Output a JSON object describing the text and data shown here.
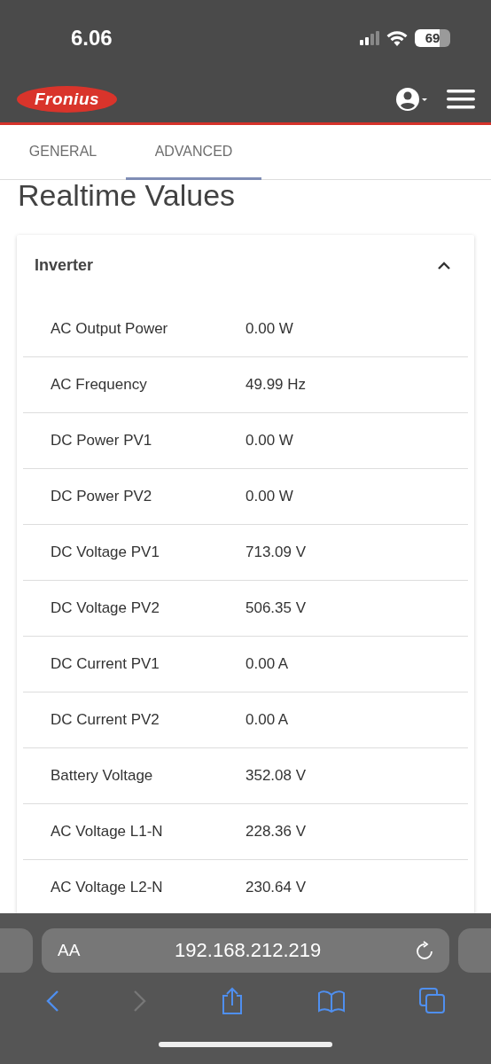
{
  "status_bar": {
    "time": "6.06",
    "battery": "69"
  },
  "header": {
    "logo": "Fronius"
  },
  "tabs": [
    {
      "label": "GENERAL",
      "selected": false
    },
    {
      "label": "ADVANCED",
      "selected": true
    }
  ],
  "page_title": "Realtime Values",
  "panel": {
    "title": "Inverter",
    "expanded": true,
    "rows": [
      {
        "label": "AC Output Power",
        "value": "0.00 W"
      },
      {
        "label": "AC Frequency",
        "value": "49.99 Hz"
      },
      {
        "label": "DC Power PV1",
        "value": "0.00 W"
      },
      {
        "label": "DC Power PV2",
        "value": "0.00 W"
      },
      {
        "label": "DC Voltage PV1",
        "value": "713.09 V"
      },
      {
        "label": "DC Voltage PV2",
        "value": "506.35 V"
      },
      {
        "label": "DC Current PV1",
        "value": "0.00 A"
      },
      {
        "label": "DC Current PV2",
        "value": "0.00 A"
      },
      {
        "label": "Battery Voltage",
        "value": "352.08 V"
      },
      {
        "label": "AC Voltage L1-N",
        "value": "228.36 V"
      },
      {
        "label": "AC Voltage L2-N",
        "value": "230.64 V"
      }
    ]
  },
  "browser": {
    "text_size": "AA",
    "url": "192.168.212.219",
    "forward_disabled": true
  }
}
